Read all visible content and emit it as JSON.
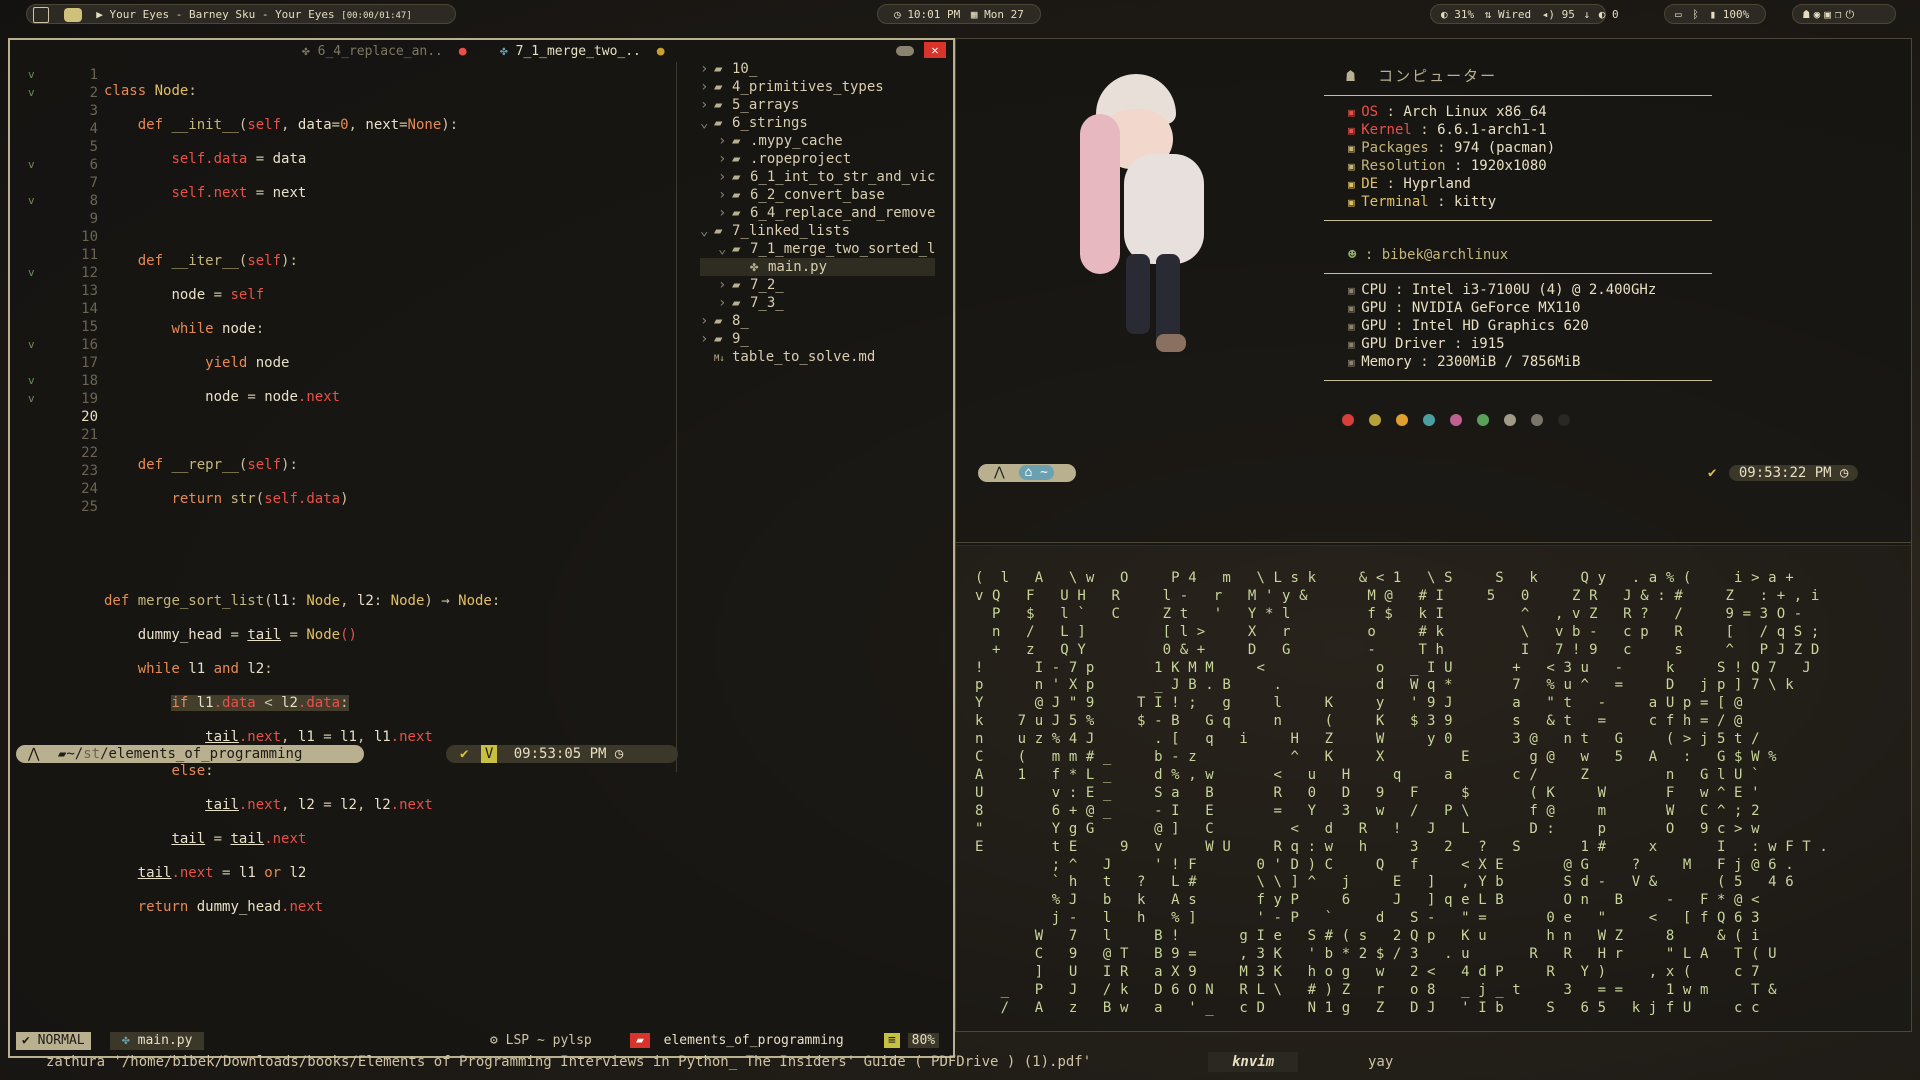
{
  "topbar": {
    "media": "Your Eyes - Barney Sku - Your Eyes",
    "media_time": "[00:00/01:47]",
    "clock": "10:01 PM",
    "date": "Mon 27",
    "cpu": "31%",
    "network": "Wired",
    "volume": "95",
    "brightness": "0",
    "battery": "100%"
  },
  "editor": {
    "tabs": [
      {
        "label": "6_4_replace_an.."
      },
      {
        "label": "7_1_merge_two_.."
      }
    ],
    "current_line": 20,
    "lines": [
      {
        "n": 1,
        "fold": "v"
      },
      {
        "n": 2,
        "fold": "v"
      },
      {
        "n": 3,
        "fold": ""
      },
      {
        "n": 4,
        "fold": ""
      },
      {
        "n": 5,
        "fold": ""
      },
      {
        "n": 6,
        "fold": "v"
      },
      {
        "n": 7,
        "fold": ""
      },
      {
        "n": 8,
        "fold": "v"
      },
      {
        "n": 9,
        "fold": ""
      },
      {
        "n": 10,
        "fold": ""
      },
      {
        "n": 11,
        "fold": ""
      },
      {
        "n": 12,
        "fold": "v"
      },
      {
        "n": 13,
        "fold": ""
      },
      {
        "n": 14,
        "fold": ""
      },
      {
        "n": 15,
        "fold": ""
      },
      {
        "n": 16,
        "fold": "v"
      },
      {
        "n": 17,
        "fold": ""
      },
      {
        "n": 18,
        "fold": "v"
      },
      {
        "n": 19,
        "fold": "v"
      },
      {
        "n": 20,
        "fold": ""
      },
      {
        "n": 21,
        "fold": ""
      },
      {
        "n": 22,
        "fold": ""
      },
      {
        "n": 23,
        "fold": ""
      },
      {
        "n": 24,
        "fold": ""
      },
      {
        "n": 25,
        "fold": ""
      }
    ]
  },
  "tree": {
    "items": [
      {
        "label": "10_",
        "depth": 0,
        "type": "folder",
        "open": false
      },
      {
        "label": "4_primitives_types",
        "depth": 0,
        "type": "folder",
        "open": false
      },
      {
        "label": "5_arrays",
        "depth": 0,
        "type": "folder",
        "open": false
      },
      {
        "label": "6_strings",
        "depth": 0,
        "type": "folder",
        "open": true
      },
      {
        "label": ".mypy_cache",
        "depth": 1,
        "type": "folder",
        "open": false
      },
      {
        "label": ".ropeproject",
        "depth": 1,
        "type": "folder",
        "open": false
      },
      {
        "label": "6_1_int_to_str_and_vic",
        "depth": 1,
        "type": "folder",
        "open": false
      },
      {
        "label": "6_2_convert_base",
        "depth": 1,
        "type": "folder",
        "open": false
      },
      {
        "label": "6_4_replace_and_remove",
        "depth": 1,
        "type": "folder",
        "open": false
      },
      {
        "label": "7_linked_lists",
        "depth": 0,
        "type": "folder",
        "open": true
      },
      {
        "label": "7_1_merge_two_sorted_l",
        "depth": 1,
        "type": "folder",
        "open": true
      },
      {
        "label": "main.py",
        "depth": 2,
        "type": "file",
        "open": false
      },
      {
        "label": "7_2_",
        "depth": 1,
        "type": "folder",
        "open": false
      },
      {
        "label": "7_3_",
        "depth": 1,
        "type": "folder",
        "open": false
      },
      {
        "label": "8_",
        "depth": 0,
        "type": "folder",
        "open": false
      },
      {
        "label": "9_",
        "depth": 0,
        "type": "folder",
        "open": false
      },
      {
        "label": "table_to_solve.md",
        "depth": 0,
        "type": "md",
        "open": false
      }
    ]
  },
  "prompt_left": {
    "path_prefix": "~/",
    "path_dim": "st",
    "path": "/elements_of_programming",
    "time": "09:53:05 PM"
  },
  "statusline": {
    "mode": "NORMAL",
    "file": "main.py",
    "lsp": "LSP ~ pylsp",
    "project": "elements_of_programming",
    "percent": "80%"
  },
  "cmdline": {
    "text": "zathura '/home/bibek/Downloads/books/Elements of Programming Interviews in Python_ The Insiders' Guide ( PDFDrive ) (1).pdf'",
    "win1": "knvim",
    "win2": "yay"
  },
  "neofetch": {
    "header": "コンピューター",
    "rows1": [
      {
        "label": "OS",
        "value": "Arch Linux x86_64",
        "color": "#e8504a"
      },
      {
        "label": "Kernel",
        "value": "6.6.1-arch1-1",
        "color": "#e8504a"
      },
      {
        "label": "Packages",
        "value": "974 (pacman)",
        "color": "#c5b57a"
      },
      {
        "label": "Resolution",
        "value": "1920x1080",
        "color": "#c5b57a"
      },
      {
        "label": "DE",
        "value": "Hyprland",
        "color": "#e0c060"
      },
      {
        "label": "Terminal",
        "value": "kitty",
        "color": "#e0c060"
      }
    ],
    "user": "bibek@archlinux",
    "rows2": [
      {
        "label": "CPU",
        "value": "Intel i3-7100U (4) @ 2.400GHz"
      },
      {
        "label": "GPU",
        "value": "NVIDIA GeForce MX110"
      },
      {
        "label": "GPU",
        "value": "Intel HD Graphics 620"
      },
      {
        "label": "GPU Driver",
        "value": "i915"
      },
      {
        "label": "Memory",
        "value": "2300MiB / 7856MiB"
      }
    ],
    "palette": [
      "#d6403a",
      "#b5a33a",
      "#e0a030",
      "#4aa0a0",
      "#c06090",
      "#5aa05a",
      "#a09a88",
      "#7a7568",
      "#2a2824"
    ]
  },
  "prompt_right": {
    "home": "~",
    "time": "09:53:22 PM"
  },
  "matrix": [
    "(  l   A   \\ w   O     P 4   m   \\ L s k     & < 1   \\ S     S   k     Q y   . a % (     i > a +",
    "v Q   F   U H   R     l -   r   M ' y &       M @   # I     5   0     Z R   J & : #     Z   : + , i",
    "  P   $   l `   C     Z t   '   Y * l         f $   k I         ^   , v Z   R ?   /     9 = 3 O -",
    "  n   /   L ]         [ l >     X   r         o     # k         \\   v b -   c p   R     [   / q S ;",
    "  +   z   Q Y         0 & +     D   G         -     T h         I   7 ! 9   c     s     ^   P J Z D",
    "!      I - 7 p       1 K M M     <             o   _ I U       +   < 3 u   -     k     S ! Q 7   J",
    "p      n ' X p       _ J B . B     .           d   W q *       7   % u ^   =     D   j p ] 7 \\ k",
    "Y      @ J \" 9     T I ! ;   g     l     K     y   ' 9 J       a   \" t   -     a U p = [ @",
    "k    7 u J 5 %     $ - B   G q     n     (     K   $ 3 9       s   & t   =     c f h = / @",
    "n    u z % 4 J       . [   q   i     H   Z     W     y 0       3 @   n t   G     ( > j 5 t /",
    "C    (   m m # _     b - z           ^   K     X         E       g @   w   5   A   :   G $ W %",
    "A    1   f * L _     d % , w       <   u   H     q     a       c /     Z         n   G l U `",
    "U        v : E _     S a   B       R   0   D   9   F     $       ( K     W       F   w ^ E '",
    "8        6 + @ _     - I   E       =   Y   3   w   /   P \\       f @     m       W   C ^ ; 2",
    "\"        Y g G       @ ]   C         <   d   R   !   J   L       D :     p       O   9 c > w",
    "E        t E     9   v     W U     R q : w   h     3   2   ?   S       1 #     x       I   : w F T .",
    "         ; ^   J     ' ! F       0 ' D ) C     Q   f     < X E       @ G     ?     M   F j @ 6 .",
    "         ` h   t   ?   L #       \\ \\ ] ^   j     E   ]   , Y b       S d -   V &       ( 5   4 6",
    "         % J   b   k   A s       f y P     6     J   ] q e L B       O n   B     -   F * @ <",
    "         j -   l   h   % ]       ' - P   `     d   S -   \" =       0 e   \"     <   [ f Q 6 3",
    "       W   7   l     B !       g I e   S # ( s   2 Q p   K u       h n   W Z     8     & ( i",
    "       C   9   @ T   B 9 =     , 3 K   ' b * 2 $ / 3   . u       R   R   H r     \" L A   T ( U",
    "       ]   U   I R   a X 9     M 3 K   h o g   w   2 <   4 d P     R   Y )     , x (     c 7",
    "   _   P   J   / k   D 6 O N   R L \\   # ) Z   r   o 8   _ j _ t     3   = =     1 w m     T &",
    "   /   A   z   B w   a   ' _   c D     N 1 g   Z   D J   ' I b     S   6 5   k j f U     c c"
  ]
}
